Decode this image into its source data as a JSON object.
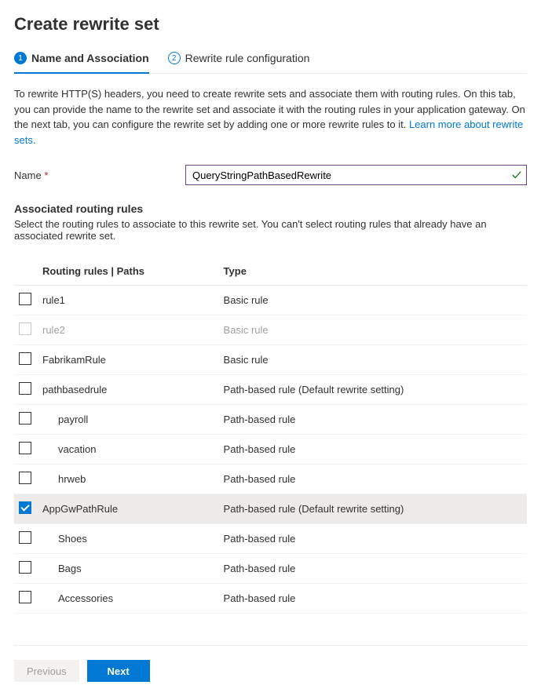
{
  "title": "Create rewrite set",
  "tabs": [
    {
      "num": "1",
      "label": "Name and Association",
      "active": true
    },
    {
      "num": "2",
      "label": "Rewrite rule configuration",
      "active": false
    }
  ],
  "description": "To rewrite HTTP(S) headers, you need to create rewrite sets and associate them with routing rules. On this tab, you can provide the name to the rewrite set and associate it with the routing rules in your application gateway. On the next tab, you can configure the rewrite set by adding one or more rewrite rules to it.  ",
  "learn_more": "Learn more about rewrite sets.",
  "name_label": "Name",
  "name_value": "QueryStringPathBasedRewrite",
  "assoc_heading": "Associated routing rules",
  "assoc_desc": "Select the routing rules to associate to this rewrite set. You can't select routing rules that already have an associated rewrite set.",
  "table": {
    "headers": {
      "name": "Routing rules | Paths",
      "type": "Type"
    },
    "rows": [
      {
        "name": "rule1",
        "type": "Basic rule",
        "checked": false,
        "disabled": false,
        "indent": 0
      },
      {
        "name": "rule2",
        "type": "Basic rule",
        "checked": false,
        "disabled": true,
        "indent": 0
      },
      {
        "name": "FabrikamRule",
        "type": "Basic rule",
        "checked": false,
        "disabled": false,
        "indent": 0
      },
      {
        "name": "pathbasedrule",
        "type": "Path-based rule (Default rewrite setting)",
        "checked": false,
        "disabled": false,
        "indent": 0
      },
      {
        "name": "payroll",
        "type": "Path-based rule",
        "checked": false,
        "disabled": false,
        "indent": 1
      },
      {
        "name": "vacation",
        "type": "Path-based rule",
        "checked": false,
        "disabled": false,
        "indent": 1
      },
      {
        "name": "hrweb",
        "type": "Path-based rule",
        "checked": false,
        "disabled": false,
        "indent": 1
      },
      {
        "name": "AppGwPathRule",
        "type": "Path-based rule (Default rewrite setting)",
        "checked": true,
        "disabled": false,
        "indent": 0
      },
      {
        "name": "Shoes",
        "type": "Path-based rule",
        "checked": false,
        "disabled": false,
        "indent": 1
      },
      {
        "name": "Bags",
        "type": "Path-based rule",
        "checked": false,
        "disabled": false,
        "indent": 1
      },
      {
        "name": "Accessories",
        "type": "Path-based rule",
        "checked": false,
        "disabled": false,
        "indent": 1
      }
    ]
  },
  "buttons": {
    "previous": "Previous",
    "next": "Next"
  }
}
